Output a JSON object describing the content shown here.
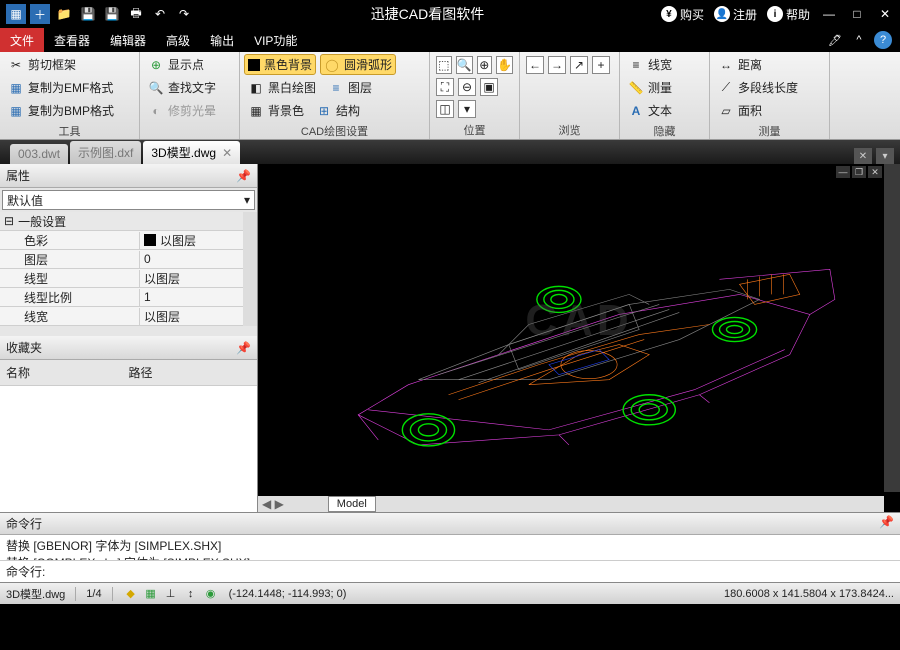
{
  "title": "迅捷CAD看图软件",
  "titlebar": {
    "buy": "购买",
    "register": "注册",
    "help": "帮助"
  },
  "menu": {
    "tabs": [
      "文件",
      "查看器",
      "编辑器",
      "高级",
      "输出",
      "VIP功能"
    ],
    "active": 0
  },
  "ribbon": {
    "groups": {
      "tools": {
        "label": "工具",
        "clip": "剪切框架",
        "emf": "复制为EMF格式",
        "bmp": "复制为BMP格式"
      },
      "find": {
        "show_points": "显示点",
        "find_text": "查找文字",
        "edit_halo": "修剪光晕"
      },
      "cad": {
        "label": "CAD绘图设置",
        "black_bg": "黑色背景",
        "bw": "黑白绘图",
        "bgcolor": "背景色",
        "arc": "圆滑弧形",
        "layers": "图层",
        "struct": "结构"
      },
      "pos": {
        "label": "位置"
      },
      "browse": {
        "label": "浏览"
      },
      "hide": {
        "label": "隐藏",
        "linew": "线宽",
        "measure": "测量",
        "text": "文本"
      },
      "meas": {
        "label": "测量",
        "dist": "距离",
        "polylen": "多段线长度",
        "area": "面积"
      }
    }
  },
  "doctabs": {
    "items": [
      "003.dwt",
      "示例图.dxf",
      "3D模型.dwg"
    ],
    "active": 2
  },
  "props": {
    "title": "属性",
    "default": "默认值",
    "cat1": "一般设置",
    "rows": [
      {
        "k": "色彩",
        "v": "以图层",
        "swatch": true
      },
      {
        "k": "图层",
        "v": "0"
      },
      {
        "k": "线型",
        "v": "以图层"
      },
      {
        "k": "线型比例",
        "v": "1"
      },
      {
        "k": "线宽",
        "v": "以图层"
      }
    ],
    "fav_title": "收藏夹",
    "fav_name": "名称",
    "fav_path": "路径"
  },
  "viewport": {
    "model_tab": "Model",
    "watermark": "CAD"
  },
  "cmd": {
    "title": "命令行",
    "lines": [
      "替换 [GBENOR] 字体为 [SIMPLEX.SHX]",
      "替换 [COMPLEX.shx] 字体为 [SIMPLEX.SHX]"
    ],
    "prompt": "命令行:"
  },
  "status": {
    "file": "3D模型.dwg",
    "frac": "1/4",
    "coords": "(-124.1448; -114.993; 0)",
    "right": "180.6008 x 141.5804 x 173.8424..."
  }
}
